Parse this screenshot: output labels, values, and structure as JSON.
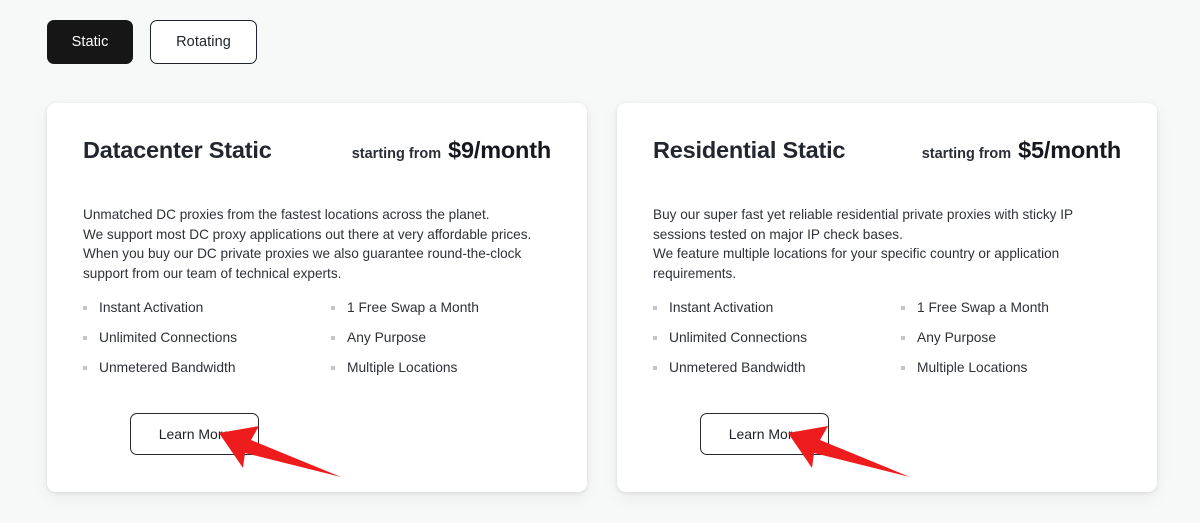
{
  "toggle": {
    "options": [
      {
        "label": "Static",
        "state": "active"
      },
      {
        "label": "Rotating",
        "state": "inactive"
      }
    ]
  },
  "cards": [
    {
      "title": "Datacenter Static",
      "price_prefix": "starting from",
      "price": "$9/month",
      "description": "Unmatched DC proxies from the fastest locations across the planet.\nWe support most DC proxy applications out there at very affordable prices.\nWhen you buy our DC private proxies we also guarantee round-the-clock\nsupport from our team of technical experts.",
      "features_left": [
        "Instant Activation",
        "Unlimited Connections",
        "Unmetered Bandwidth"
      ],
      "features_right": [
        "1 Free Swap a Month",
        "Any Purpose",
        "Multiple Locations"
      ],
      "cta_label": "Learn More"
    },
    {
      "title": "Residential Static",
      "price_prefix": "starting from",
      "price": "$5/month",
      "description": "Buy our super fast yet reliable residential private proxies with sticky IP\nsessions tested on major IP check bases.\nWe feature multiple locations for your specific country or application\nrequirements.",
      "features_left": [
        "Instant Activation",
        "Unlimited Connections",
        "Unmetered Bandwidth"
      ],
      "features_right": [
        "1 Free Swap a Month",
        "Any Purpose",
        "Multiple Locations"
      ],
      "cta_label": "Learn More"
    }
  ],
  "annotations": {
    "arrow_color": "#ee1c1c",
    "arrows": [
      {
        "name": "arrow-pointing-to-datacenter-learn-more"
      },
      {
        "name": "arrow-pointing-to-residential-learn-more"
      }
    ]
  },
  "colors": {
    "page_background": "#f7f8f8",
    "card_background": "#ffffff",
    "active_toggle_background": "#161616",
    "text_primary": "#22262e",
    "bullet": "#c4c6c9"
  }
}
